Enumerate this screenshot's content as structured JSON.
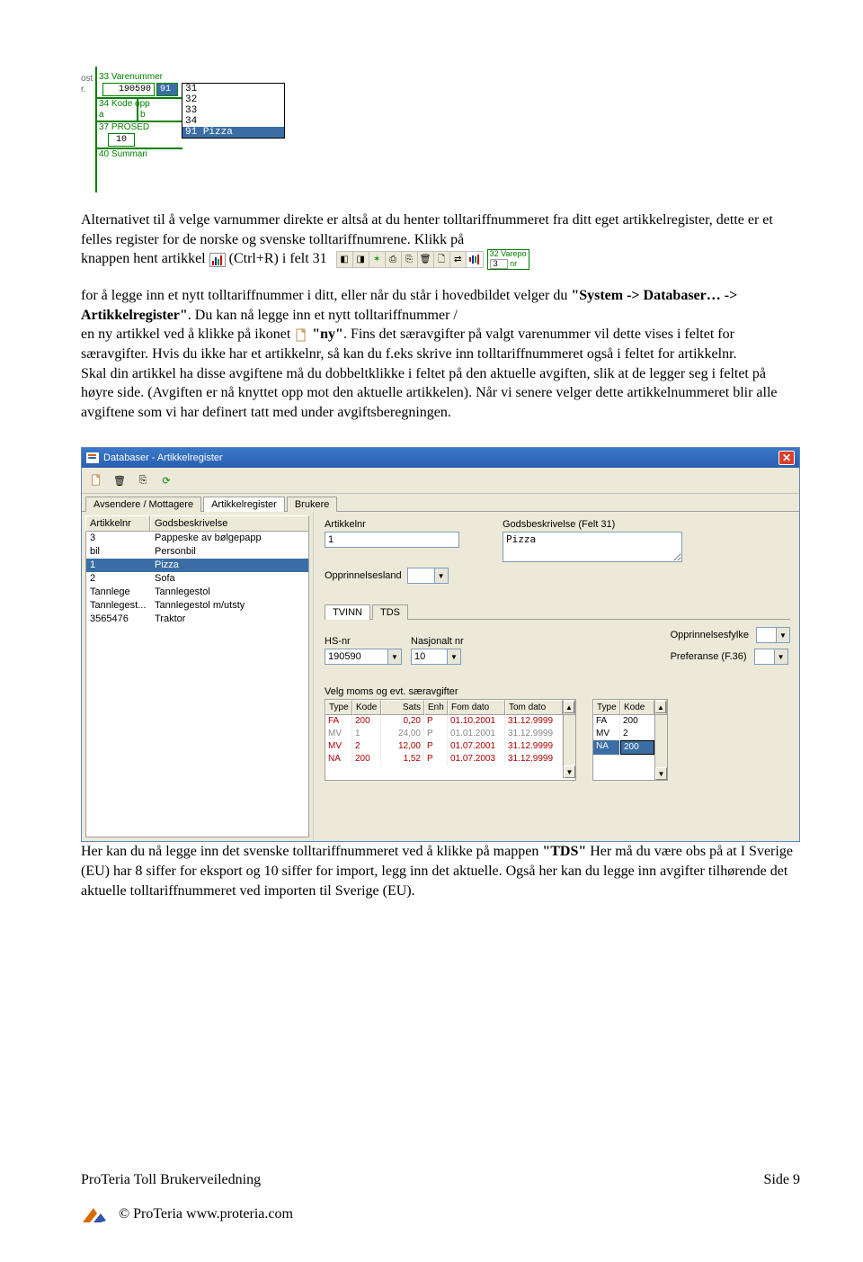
{
  "top_shot": {
    "label_varenummer": "33 Varenummer",
    "ost_prefix": "ost",
    "r_prefix": "r.",
    "val_a": "190590",
    "val_b": "91",
    "label_kodeopp": "34 Kode opp",
    "a": "a",
    "b": "b",
    "label_prosed": "37 PROSED",
    "val_prosed": "10",
    "label_summari": "40 Summari",
    "dropdown": {
      "options": [
        "31",
        "32",
        "33",
        "34"
      ],
      "selected_code": "91",
      "selected_text": "Pizza"
    }
  },
  "para1_a": "Alternativet til å velge varnummer direkte er altså at du henter tolltariffnummeret fra ditt eget artikkelregister, dette er et felles register for de norske og svenske tolltariffnumrene. Klikk på",
  "para1_b_prefix": "knappen  hent artikkel ",
  "para1_b_suffix": "  (Ctrl+R) i felt 31",
  "varepo_lbl": "32 Varepo",
  "varepo_val": "3",
  "varepo_nr": "nr",
  "para2_a": "for å legge inn et nytt tolltariffnummer i ditt, eller når du står i hovedbildet velger du ",
  "para2_b": "\"System -> Databaser… -> Artikkelregister\"",
  "para2_c": ". Du kan nå legge inn et nytt tolltariffnummer /",
  "para2_d": "en ny artikkel ved å klikke på ikonet ",
  "para2_e": " \"ny\"",
  "para2_f": ". Fins det særavgifter på valgt varenummer vil dette vises i feltet for særavgifter. Hvis du ikke har et artikkelnr, så kan du f.eks skrive inn tolltariffnummeret også i feltet for artikkelnr.",
  "para2_g": "Skal din artikkel ha disse avgiftene må du dobbeltklikke i feltet på den aktuelle avgiften, slik at de legger seg i feltet på høyre side.  (Avgiften er nå knyttet opp mot den aktuelle artikkelen). Når vi senere velger dette artikkelnummeret blir alle avgiftene som vi har definert tatt med under avgiftsberegningen.",
  "window": {
    "title": "Databaser - Artikkelregister",
    "tabs": [
      "Avsendere / Mottagere",
      "Artikkelregister",
      "Brukere"
    ],
    "active_tab": 1,
    "left": {
      "cols": [
        "Artikkelnr",
        "Godsbeskrivelse"
      ],
      "rows": [
        [
          "3",
          "Pappeske av bølgepapp"
        ],
        [
          "bil",
          "Personbil"
        ],
        [
          "1",
          "Pizza"
        ],
        [
          "2",
          "Sofa"
        ],
        [
          "Tannlege",
          "Tannlegestol"
        ],
        [
          "Tannlegest...",
          "Tannlegestol m/utsty"
        ],
        [
          "3565476",
          "Traktor"
        ]
      ],
      "selected": 2
    },
    "right": {
      "labels": {
        "artikkelnr": "Artikkelnr",
        "godsbeskrivelse": "Godsbeskrivelse (Felt 31)",
        "opprinnelsesland": "Opprinnelsesland",
        "hsnr": "HS-nr",
        "nasjonalt": "Nasjonalt nr",
        "oppfylke": "Opprinnelsesfylke",
        "preferanse": "Preferanse (F.36)",
        "moms": "Velg moms og evt. særavgifter"
      },
      "artikkelnr": "1",
      "godsbeskrivelse": "Pizza",
      "opprinnelsesland": "",
      "sect_tabs": [
        "TVINN",
        "TDS"
      ],
      "sect_active": 0,
      "hsnr": "190590",
      "nasjonalt": "10",
      "oppfylke": "",
      "preferanse": "",
      "t1": {
        "cols": [
          "Type",
          "Kode",
          "Sats",
          "Enh",
          "Fom dato",
          "Tom dato"
        ],
        "rows": [
          {
            "vals": [
              "FA",
              "200",
              "0,20",
              "P",
              "01.10.2001",
              "31.12.9999"
            ],
            "active": true
          },
          {
            "vals": [
              "MV",
              "1",
              "24,00",
              "P",
              "01.01.2001",
              "31.12.9999"
            ],
            "active": false
          },
          {
            "vals": [
              "MV",
              "2",
              "12,00",
              "P",
              "01.07.2001",
              "31.12.9999"
            ],
            "active": true
          },
          {
            "vals": [
              "NA",
              "200",
              "1,52",
              "P",
              "01.07.2003",
              "31.12.9999"
            ],
            "active": true
          }
        ]
      },
      "t2": {
        "cols": [
          "Type",
          "Kode"
        ],
        "rows": [
          {
            "vals": [
              "FA",
              "200"
            ],
            "sel": false
          },
          {
            "vals": [
              "MV",
              "2"
            ],
            "sel": false
          },
          {
            "vals": [
              "NA",
              "200"
            ],
            "sel": true
          }
        ]
      }
    }
  },
  "para3": "Her kan du nå legge inn det svenske tolltariffnummeret ved å klikke på mappen ",
  "para3b": "\"TDS\"",
  "para3c": " Her må du være obs på at I Sverige (EU) har 8 siffer for eksport og 10 siffer for import, legg inn det aktuelle. Også her kan du legge inn avgifter tilhørende det aktuelle tolltariffnummeret ved importen til Sverige (EU).",
  "footer": {
    "left": "ProTeria Toll  Brukerveiledning",
    "right": "Side 9",
    "copyright": "© ProTeria www.proteria.com"
  }
}
